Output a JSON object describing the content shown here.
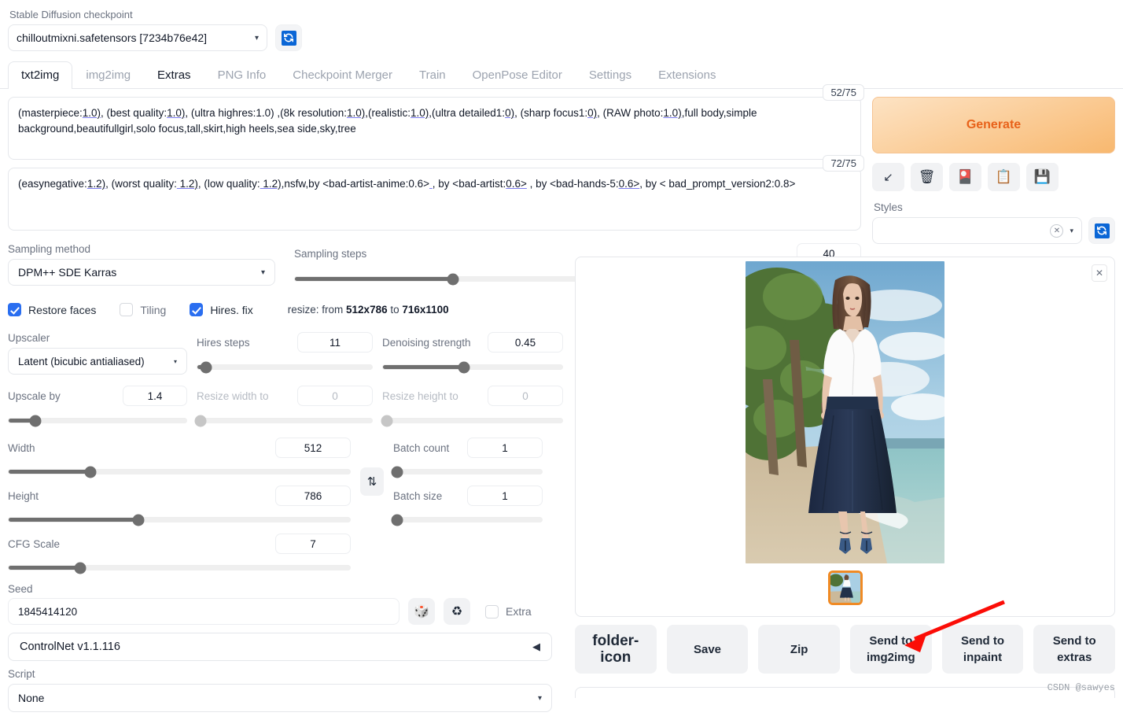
{
  "checkpoint": {
    "label": "Stable Diffusion checkpoint",
    "value": "chilloutmixni.safetensors [7234b76e42]",
    "caret": "▾",
    "refresh_icon": "refresh-icon"
  },
  "tabs": [
    {
      "label": "txt2img",
      "state": "active"
    },
    {
      "label": "img2img",
      "state": "inactive"
    },
    {
      "label": "Extras",
      "state": "hover"
    },
    {
      "label": "PNG Info",
      "state": "inactive"
    },
    {
      "label": "Checkpoint Merger",
      "state": "inactive"
    },
    {
      "label": "Train",
      "state": "inactive"
    },
    {
      "label": "OpenPose Editor",
      "state": "inactive"
    },
    {
      "label": "Settings",
      "state": "inactive"
    },
    {
      "label": "Extensions",
      "state": "inactive"
    }
  ],
  "prompt": {
    "token_count": "52/75",
    "line1_a": "(masterpiece:",
    "line1_u1": "1.0)",
    "line1_b": ", (best quality:",
    "line1_u2": "1.0)",
    "line1_c": ", (ultra highres:1.0) ,(8k resolution:",
    "line1_u3": "1.0)",
    "line1_d": ",(realistic:",
    "line1_u4": "1.0)",
    "line1_e": ",(ultra detailed1:",
    "line1_u5": "0)",
    "line1_f": ", (sharp focus1:",
    "line1_u6": "0)",
    "line1_g": ", (RAW photo:",
    "line1_u7": "1.0)",
    "line1_h": ",full body,simple background,beautifull",
    "line2": "girl,solo focus,tall,skirt,high heels,sea side,sky,tree",
    "full_text": "(masterpiece:1.0), (best quality:1.0), (ultra highres:1.0) ,(8k resolution:1.0),(realistic:1.0),(ultra detailed1:0), (sharp focus1:0), (RAW photo:1.0),full body,simple background,beautifull girl,solo focus,tall,skirt,high heels,sea side,sky,tree"
  },
  "negative_prompt": {
    "token_count": "72/75",
    "seg_a": "(easynegative:",
    "seg_u1": "1.2)",
    "seg_b": ", (worst quality:",
    "seg_u2": " 1.2)",
    "seg_c": ", (low quality:",
    "seg_u3": " 1.2)",
    "seg_d": ",nsfw,by <bad-artist-anime:0.6>",
    "seg_u4": " ",
    "seg_e": ", by <bad-artist:",
    "seg_u5": "0.6>",
    "seg_f": " , by <bad-hands-5:",
    "seg_u6": "0.6>",
    "seg_g": ", by < bad_prompt_version2:0.8>",
    "full_text": "(easynegative:1.2), (worst quality: 1.2), (low quality: 1.2),nsfw,by <bad-artist-anime:0.6> , by <bad-artist:0.6> , by <bad-hands-5:0.6>, by < bad_prompt_version2:0.8>"
  },
  "generate": {
    "label": "Generate",
    "text_color": "#e8621a",
    "bg_top": "#fde3c4",
    "bg_bottom": "#f8b86f"
  },
  "toolbar_icons": [
    {
      "name": "arrow-down-left-icon",
      "glyph": "↙"
    },
    {
      "name": "trash-icon",
      "glyph": "🗑"
    },
    {
      "name": "red-card-icon",
      "glyph": "🎴"
    },
    {
      "name": "clipboard-icon",
      "glyph": "📋"
    },
    {
      "name": "floppy-save-icon",
      "glyph": "💾"
    }
  ],
  "styles": {
    "label": "Styles",
    "value": "",
    "clear_glyph": "✕",
    "caret": "▾",
    "refresh_icon": "refresh-icon"
  },
  "sampling": {
    "method_label": "Sampling method",
    "method_value": "DPM++ SDE Karras",
    "steps_label": "Sampling steps",
    "steps_value": "40",
    "steps_percent": 28
  },
  "toggles": {
    "restore_faces": {
      "label": "Restore faces",
      "checked": true
    },
    "tiling": {
      "label": "Tiling",
      "checked": false
    },
    "hires_fix": {
      "label": "Hires. fix",
      "checked": true
    },
    "resize_note_prefix": "resize: from ",
    "resize_from": "512x786",
    "resize_mid": " to ",
    "resize_to": "716x1100"
  },
  "hires": {
    "upscaler_label": "Upscaler",
    "upscaler_value": "Latent (bicubic antialiased)",
    "hires_steps_label": "Hires steps",
    "hires_steps_value": "11",
    "hires_steps_percent": 5,
    "denoising_label": "Denoising strength",
    "denoising_value": "0.45",
    "denoising_percent": 45,
    "upscale_by_label": "Upscale by",
    "upscale_by_value": "1.4",
    "upscale_by_percent": 15,
    "resize_width_label": "Resize width to",
    "resize_width_value": "0",
    "resize_width_percent": 2,
    "resize_height_label": "Resize height to",
    "resize_height_value": "0",
    "resize_height_percent": 2
  },
  "dimensions": {
    "width_label": "Width",
    "width_value": "512",
    "width_percent": 24,
    "height_label": "Height",
    "height_value": "786",
    "height_percent": 38,
    "cfg_label": "CFG Scale",
    "cfg_value": "7",
    "cfg_percent": 21,
    "swap_glyph": "⇅",
    "batch_count_label": "Batch count",
    "batch_count_value": "1",
    "batch_count_percent": 2,
    "batch_size_label": "Batch size",
    "batch_size_value": "1",
    "batch_size_percent": 2
  },
  "seed": {
    "label": "Seed",
    "value": "1845414120",
    "dice_icon": "dice-icon",
    "recycle_icon": "recycle-icon",
    "extra_label": "Extra",
    "extra_checked": false
  },
  "controlnet": {
    "label": "ControlNet v1.1.116",
    "collapse_glyph": "◀"
  },
  "script": {
    "label": "Script",
    "value": "None",
    "caret": "▾"
  },
  "result": {
    "close_glyph": "✕",
    "thumbnail_selected": true
  },
  "actions": [
    {
      "label": "",
      "name": "open-folder-button",
      "icon": "folder-icon"
    },
    {
      "label": "Save",
      "name": "save-button"
    },
    {
      "label": "Zip",
      "name": "zip-button"
    },
    {
      "label": "Send to\nimg2img",
      "name": "send-to-img2img-button",
      "line1": "Send to",
      "line2": "img2img"
    },
    {
      "label": "Send to\ninpaint",
      "name": "send-to-inpaint-button",
      "line1": "Send to",
      "line2": "inpaint"
    },
    {
      "label": "Send to\nextras",
      "name": "send-to-extras-button",
      "line1": "Send to",
      "line2": "extras"
    }
  ],
  "annotation": {
    "arrow_color": "#fb0d07",
    "points_to": "send-to-img2img-button"
  },
  "watermark": "CSDN @sawyes"
}
